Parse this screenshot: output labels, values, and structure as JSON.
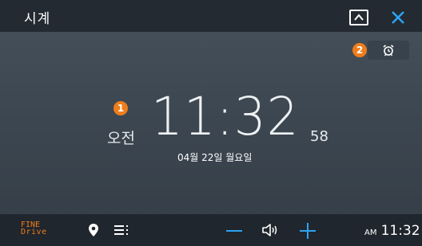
{
  "app": {
    "title": "시계"
  },
  "titlebar": {
    "collapse_icon": "chevron-up-icon",
    "close_icon": "close-icon",
    "close_color": "#2ea3f2"
  },
  "alarm": {
    "marker": "2",
    "icon": "alarm-clock-icon"
  },
  "clock": {
    "marker": "1",
    "ampm": "오전",
    "time": "11:32",
    "seconds": "58",
    "date": "04월 22일 월요일"
  },
  "bottombar": {
    "logo_line1": "FINE",
    "logo_line2": "Drive",
    "logo_color": "#f07d1b",
    "nav_icon": "map-pin-icon",
    "menu_icon": "menu-icon",
    "volume_down_icon": "minus-icon",
    "volume_icon": "speaker-icon",
    "volume_up_icon": "plus-icon",
    "accent_color": "#2ea3f2",
    "status_ampm": "AM",
    "status_time": "11:32"
  }
}
